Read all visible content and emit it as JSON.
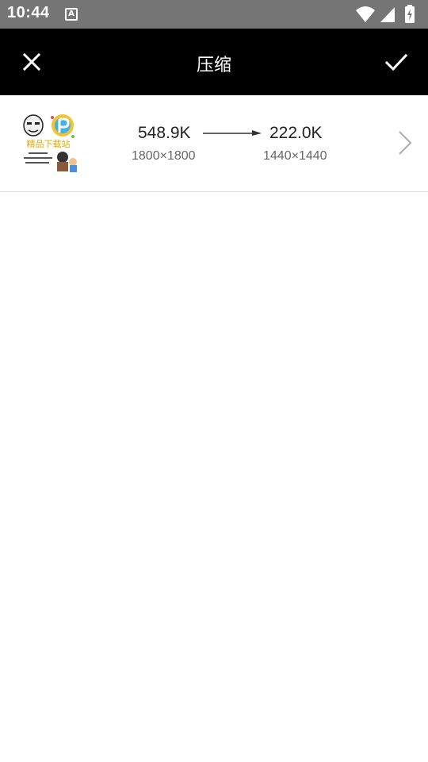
{
  "status_bar": {
    "time": "10:44",
    "notification_glyph": "A",
    "icons": [
      "wifi-icon",
      "cell-signal-icon",
      "battery-charging-icon"
    ],
    "background_color": "#757575"
  },
  "app_bar": {
    "title": "压缩",
    "close_icon": "close-icon",
    "confirm_icon": "check-icon",
    "background_color": "#000000"
  },
  "compress_item": {
    "original_size": "548.9K",
    "original_dimensions": "1800×1800",
    "compressed_size": "222.0K",
    "compressed_dimensions": "1440×1440",
    "thumbnail_icon": "image-thumbnail",
    "thumbnail_text": "精品下载站"
  }
}
